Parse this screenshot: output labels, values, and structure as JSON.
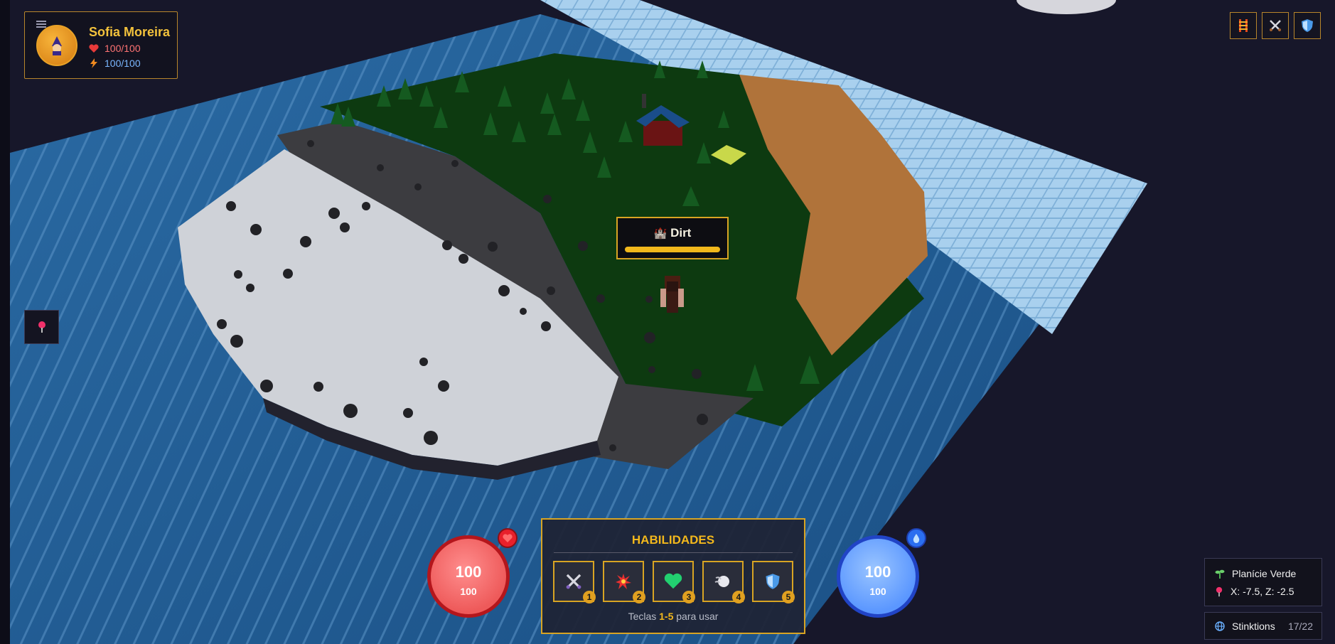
{
  "player": {
    "name": "Sofia Moreira",
    "hp_text": "100/100",
    "energy_text": "100/100",
    "avatar_icon": "mage-icon"
  },
  "top_buttons": [
    {
      "name": "ladder-icon"
    },
    {
      "name": "crossed-swords-icon"
    },
    {
      "name": "shield-icon"
    }
  ],
  "map_pin_icon": "map-pin-icon",
  "tile_tooltip": {
    "icon": "castle-icon",
    "label": "Dirt"
  },
  "hp_orb": {
    "value": "100",
    "max": "100",
    "icon": "heart-icon"
  },
  "mana_orb": {
    "value": "100",
    "max": "100",
    "icon": "droplet-icon"
  },
  "skills": {
    "title": "HABILIDADES",
    "hint_prefix": "Teclas",
    "hint_keys": "1-5",
    "hint_suffix": "para usar",
    "slots": [
      {
        "key": "1",
        "icon": "crossed-swords-icon"
      },
      {
        "key": "2",
        "icon": "explosion-icon"
      },
      {
        "key": "3",
        "icon": "green-heart-icon"
      },
      {
        "key": "4",
        "icon": "whirlwind-icon"
      },
      {
        "key": "5",
        "icon": "shield-icon"
      }
    ]
  },
  "zone": {
    "name": "Planície Verde",
    "coords": "X: -7.5, Z: -2.5"
  },
  "server": {
    "name": "Stinktions",
    "count": "17/22"
  },
  "colors": {
    "accent": "#d8a423",
    "hp": "#ee5a5a",
    "mana": "#5b97ff",
    "ocean": "#1f5b91",
    "grass": "#0e3c12",
    "sand": "#b0733a",
    "stone": "#3c3c40",
    "snow": "#cfd2d8"
  }
}
